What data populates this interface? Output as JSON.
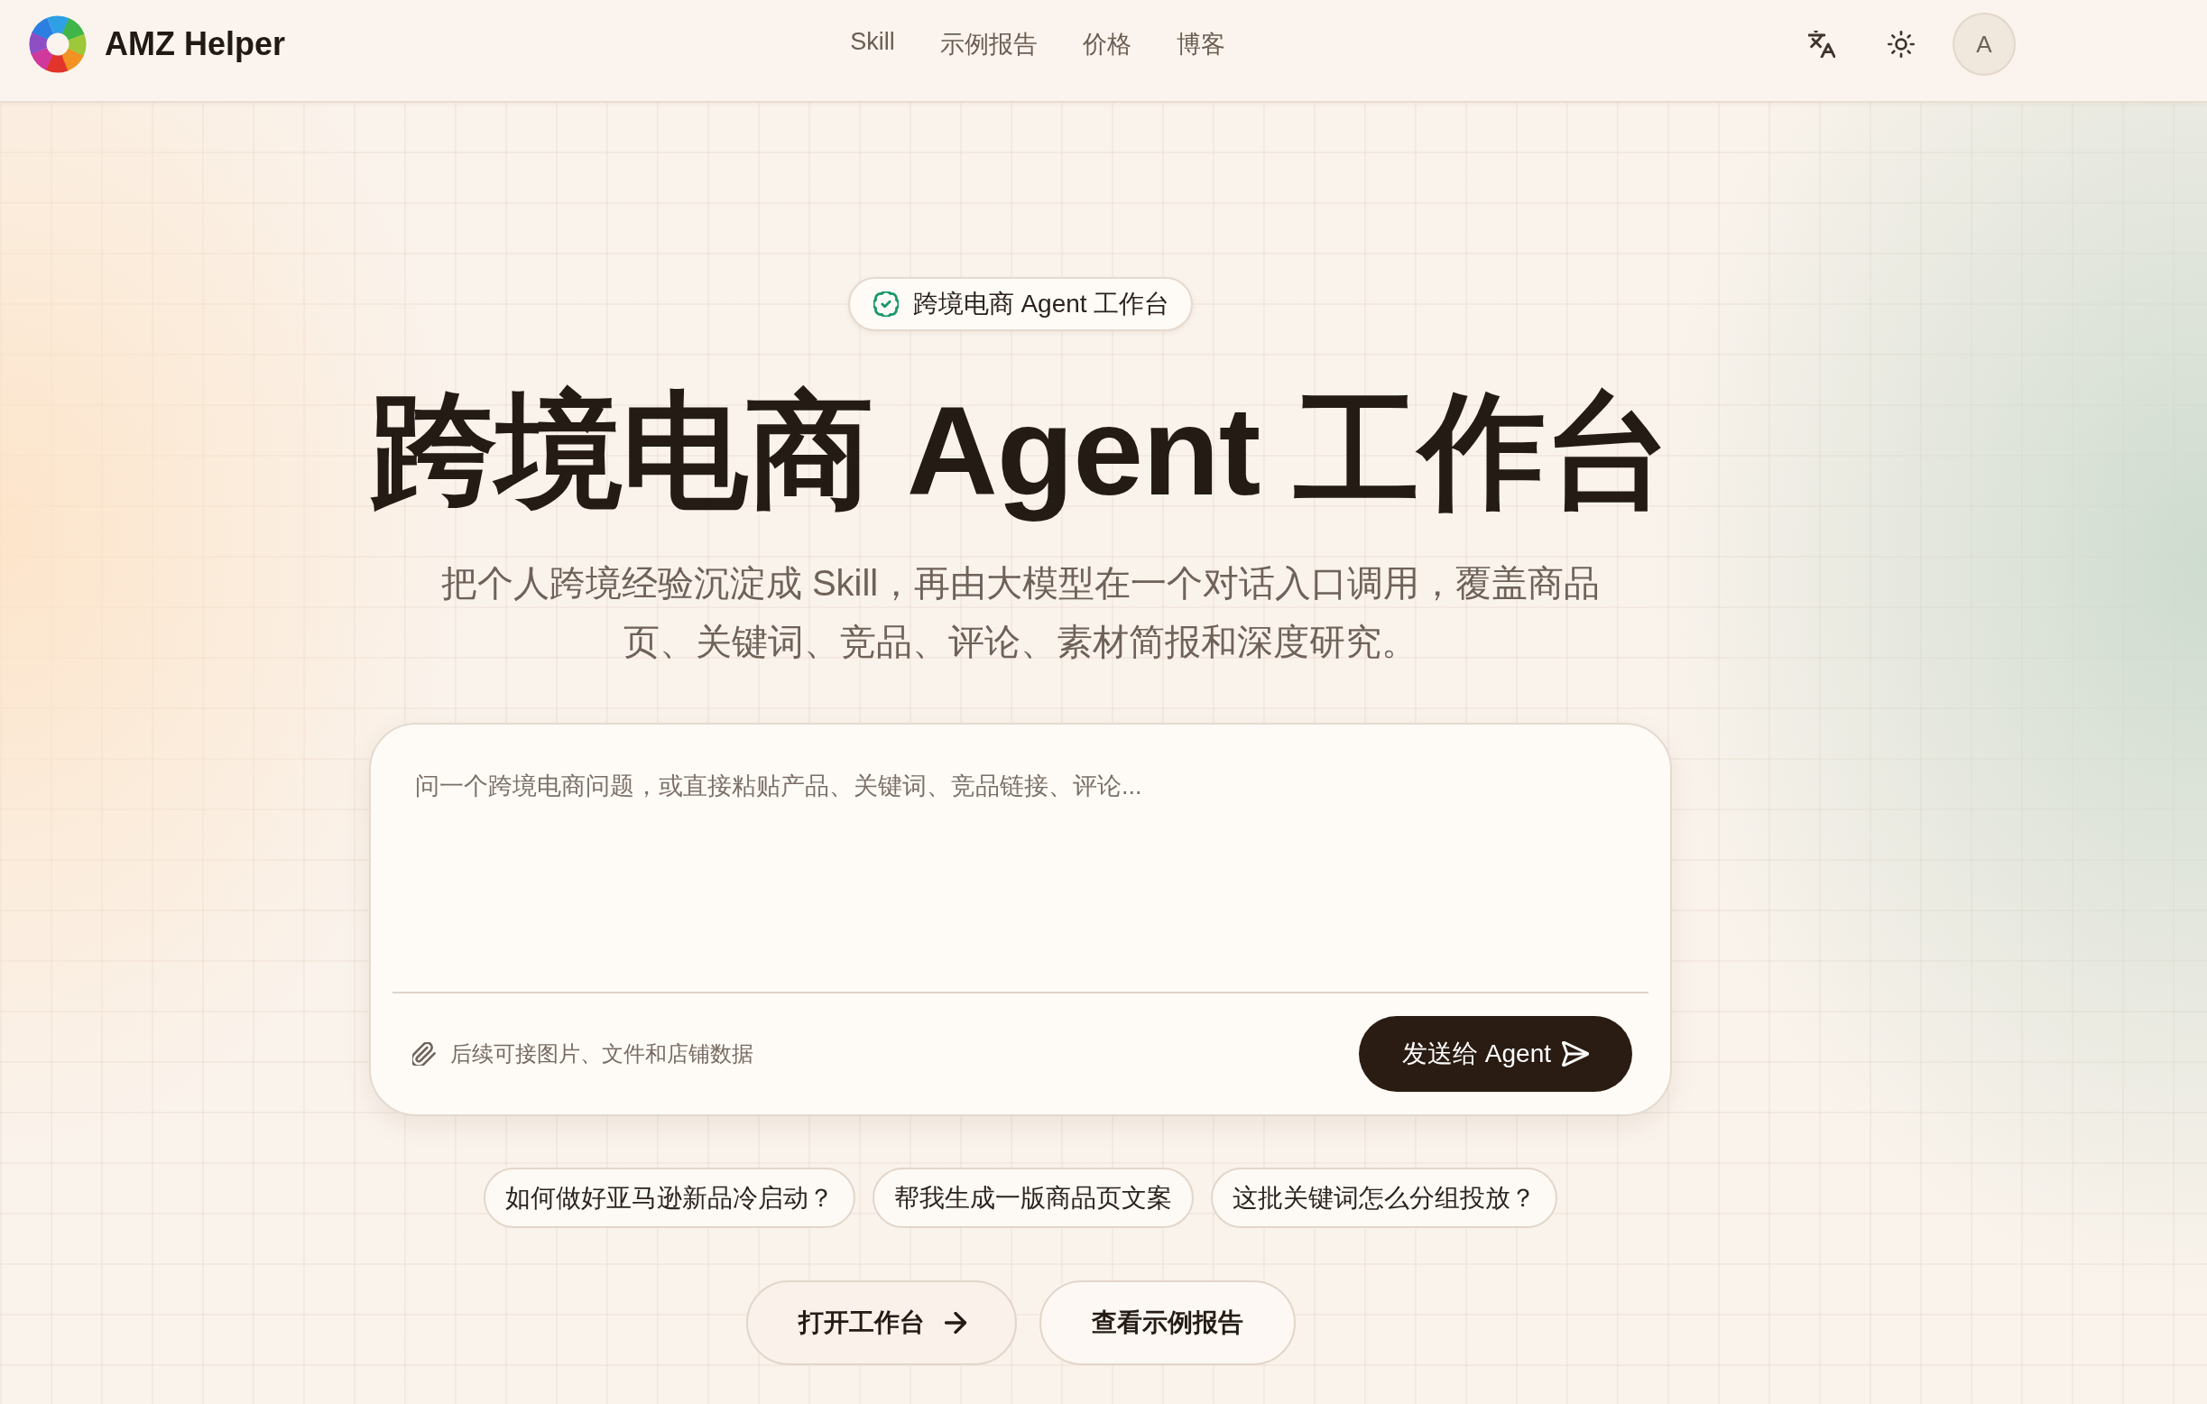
{
  "header": {
    "brand": "AMZ Helper",
    "nav": [
      "Skill",
      "示例报告",
      "价格",
      "博客"
    ],
    "avatar": "A"
  },
  "hero": {
    "badge": "跨境电商 Agent 工作台",
    "title": "跨境电商 Agent 工作台",
    "subtitle": "把个人跨境经验沉淀成 Skill，再由大模型在一个对话入口调用，覆盖商品页、关键词、竞品、评论、素材简报和深度研究。"
  },
  "composer": {
    "placeholder": "问一个跨境电商问题，或直接粘贴产品、关键词、竞品链接、评论...",
    "attachment_hint": "后续可接图片、文件和店铺数据",
    "send_button": "发送给 Agent"
  },
  "suggestions": [
    "如何做好亚马逊新品冷启动？",
    "帮我生成一版商品页文案",
    "这批关键词怎么分组投放？"
  ],
  "actions": [
    {
      "label": "打开工作台",
      "kind": "primary"
    },
    {
      "label": "查看示例报告",
      "kind": "secondary"
    }
  ]
}
